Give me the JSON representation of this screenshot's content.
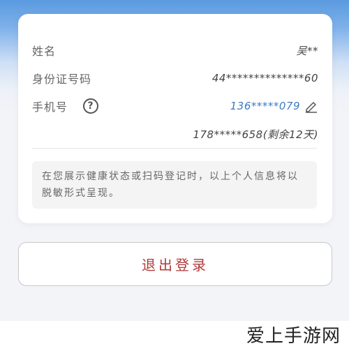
{
  "profile": {
    "name_label": "姓名",
    "name_value": "吴**",
    "id_label": "身份证号码",
    "id_value": "44**************60",
    "phone_label": "手机号",
    "phone_value": "136*****079",
    "extra_phone_value": "178*****658(剩余12天)"
  },
  "icons": {
    "help": "question-circle-icon",
    "edit": "pencil-icon"
  },
  "notice": {
    "text": "在您展示健康状态或扫码登记时，以上个人信息将以脱敏形式呈现。"
  },
  "actions": {
    "logout_label": "退出登录"
  },
  "watermark": {
    "text": "爱上手游网"
  },
  "colors": {
    "accent_blue": "#3d7bc2",
    "logout_red": "#b03a3a"
  }
}
